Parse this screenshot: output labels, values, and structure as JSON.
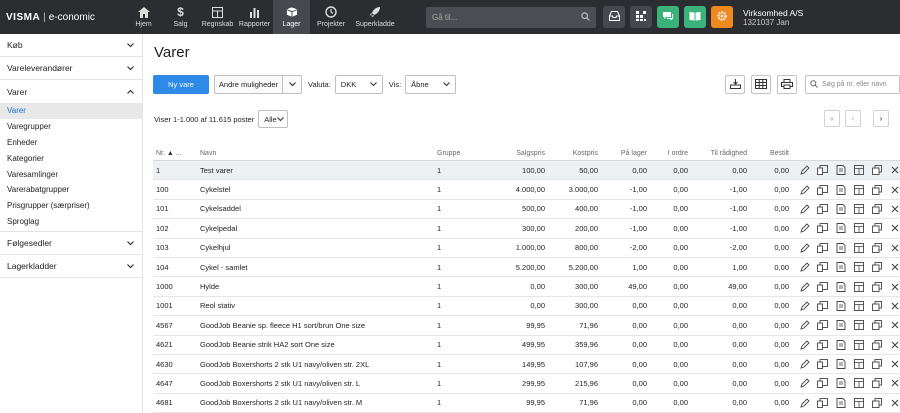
{
  "brand": {
    "logo": "VISMA",
    "product": "e-conomic"
  },
  "nav": [
    {
      "label": "Hjem",
      "icon": "home-icon"
    },
    {
      "label": "Salg",
      "icon": "dollar-icon"
    },
    {
      "label": "Regnskab",
      "icon": "ledger-icon"
    },
    {
      "label": "Rapporter",
      "icon": "bar-chart-icon"
    },
    {
      "label": "Lager",
      "icon": "warehouse-icon"
    },
    {
      "label": "Projekter",
      "icon": "clock-icon"
    },
    {
      "label": "Superkladde",
      "icon": "rocket-icon"
    }
  ],
  "nav_active": "Lager",
  "search": {
    "placeholder": "Gå til..."
  },
  "account": {
    "company": "Virksomhed A/S",
    "user": "1321037 Jan"
  },
  "sidebar": {
    "sections": [
      {
        "label": "Køb",
        "expanded": false
      },
      {
        "label": "Vareleverandører",
        "expanded": false
      },
      {
        "label": "Varer",
        "expanded": true
      },
      {
        "label": "Følgesedler",
        "expanded": false
      },
      {
        "label": "Lagerkladder",
        "expanded": false
      }
    ],
    "varer_items": [
      "Varer",
      "Varegrupper",
      "Enheder",
      "Kategorier",
      "Varesamlinger",
      "Varerabatgrupper",
      "Prisgrupper (særpriser)",
      "Sproglag"
    ],
    "active_item": "Varer"
  },
  "page": {
    "title": "Varer",
    "new_button": "Ny vare",
    "more_button": "Andre muligheder",
    "currency_label": "Valuta:",
    "currency_value": "DKK",
    "show_label": "Vis:",
    "show_value": "Åbne",
    "search_placeholder": "Søg på nr. eller navn",
    "count_text": "Viser 1-1.000 af 11.615 poster",
    "page_size": "Alle"
  },
  "table": {
    "headers": {
      "nr": "Nr.",
      "navn": "Navn",
      "gruppe": "Gruppe",
      "salgspris": "Salgspris",
      "kostpris": "Kostpris",
      "paa_lager": "På lager",
      "i_ordre": "I ordre",
      "til_raadighed": "Til rådighed",
      "bestilt": "Bestilt"
    },
    "rows": [
      {
        "nr": "1",
        "navn": "Test varer",
        "gruppe": "1",
        "salgspris": "100,00",
        "kostpris": "50,00",
        "paa_lager": "0,00",
        "i_ordre": "0,00",
        "til_raadighed": "0,00",
        "bestilt": "0,00"
      },
      {
        "nr": "100",
        "navn": "Cykelstel",
        "gruppe": "1",
        "salgspris": "4.000,00",
        "kostpris": "3.000,00",
        "paa_lager": "-1,00",
        "i_ordre": "0,00",
        "til_raadighed": "-1,00",
        "bestilt": "0,00"
      },
      {
        "nr": "101",
        "navn": "Cykelsaddel",
        "gruppe": "1",
        "salgspris": "500,00",
        "kostpris": "400,00",
        "paa_lager": "-1,00",
        "i_ordre": "0,00",
        "til_raadighed": "-1,00",
        "bestilt": "0,00"
      },
      {
        "nr": "102",
        "navn": "Cykelpedal",
        "gruppe": "1",
        "salgspris": "300,00",
        "kostpris": "200,00",
        "paa_lager": "-1,00",
        "i_ordre": "0,00",
        "til_raadighed": "-1,00",
        "bestilt": "0,00"
      },
      {
        "nr": "103",
        "navn": "Cykelhjul",
        "gruppe": "1",
        "salgspris": "1.000,00",
        "kostpris": "800,00",
        "paa_lager": "-2,00",
        "i_ordre": "0,00",
        "til_raadighed": "-2,00",
        "bestilt": "0,00"
      },
      {
        "nr": "104",
        "navn": "Cykel - samlet",
        "gruppe": "1",
        "salgspris": "5.200,00",
        "kostpris": "5.200,00",
        "paa_lager": "1,00",
        "i_ordre": "0,00",
        "til_raadighed": "1,00",
        "bestilt": "0,00"
      },
      {
        "nr": "1000",
        "navn": "Hylde",
        "gruppe": "1",
        "salgspris": "0,00",
        "kostpris": "300,00",
        "paa_lager": "49,00",
        "i_ordre": "0,00",
        "til_raadighed": "49,00",
        "bestilt": "0,00"
      },
      {
        "nr": "1001",
        "navn": "Reol stativ",
        "gruppe": "1",
        "salgspris": "0,00",
        "kostpris": "300,00",
        "paa_lager": "0,00",
        "i_ordre": "0,00",
        "til_raadighed": "0,00",
        "bestilt": "0,00"
      },
      {
        "nr": "4567",
        "navn": "GoodJob Beanie sp. fleece H1 sort/brun One size",
        "gruppe": "1",
        "salgspris": "99,95",
        "kostpris": "71,96",
        "paa_lager": "0,00",
        "i_ordre": "0,00",
        "til_raadighed": "0,00",
        "bestilt": "0,00"
      },
      {
        "nr": "4621",
        "navn": "GoodJob Beanie strik HA2 sort One size",
        "gruppe": "1",
        "salgspris": "499,95",
        "kostpris": "359,96",
        "paa_lager": "0,00",
        "i_ordre": "0,00",
        "til_raadighed": "0,00",
        "bestilt": "0,00"
      },
      {
        "nr": "4630",
        "navn": "GoodJob Boxershorts 2 stk U1 navy/oliven str. 2XL",
        "gruppe": "1",
        "salgspris": "149,95",
        "kostpris": "107,96",
        "paa_lager": "0,00",
        "i_ordre": "0,00",
        "til_raadighed": "0,00",
        "bestilt": "0,00"
      },
      {
        "nr": "4647",
        "navn": "GoodJob Boxershorts 2 stk U1 navy/oliven str. L",
        "gruppe": "1",
        "salgspris": "299,95",
        "kostpris": "215,96",
        "paa_lager": "0,00",
        "i_ordre": "0,00",
        "til_raadighed": "0,00",
        "bestilt": "0,00"
      },
      {
        "nr": "4681",
        "navn": "GoodJob Boxershorts 2 stk U1 navy/oliven str. M",
        "gruppe": "1",
        "salgspris": "99,95",
        "kostpris": "71,96",
        "paa_lager": "0,00",
        "i_ordre": "0,00",
        "til_raadighed": "0,00",
        "bestilt": "0,00"
      }
    ],
    "highlight_row": 0
  },
  "colors": {
    "topbar": "#2b2d30",
    "primary": "#2d8ae6",
    "green": "#3bb27a",
    "orange": "#f0891d",
    "link": "#1b73c9"
  }
}
